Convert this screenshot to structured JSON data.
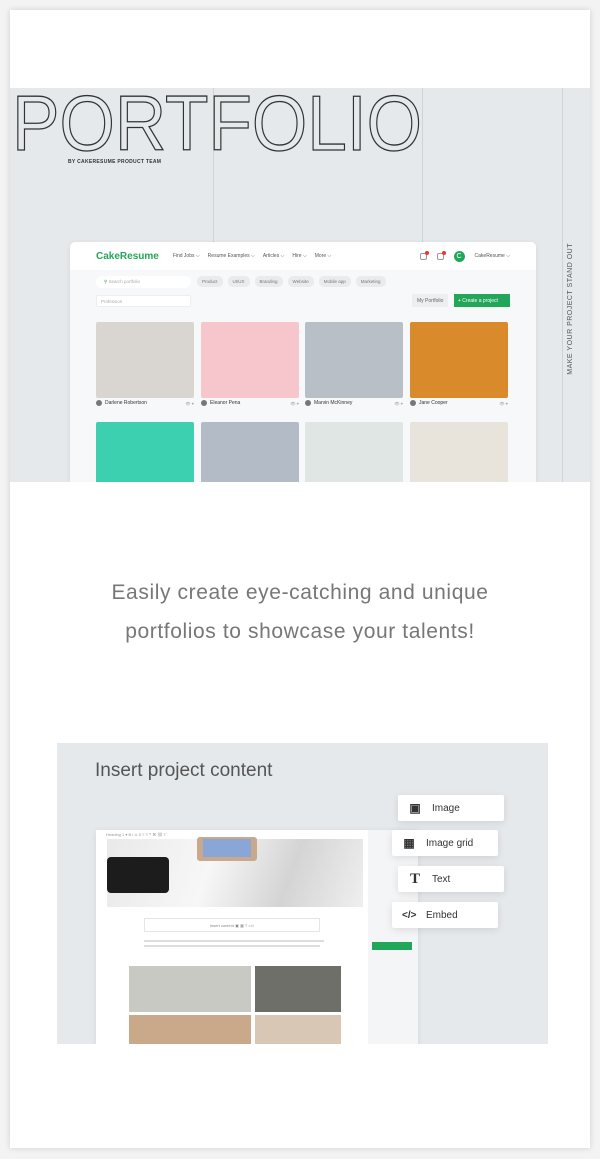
{
  "hero": {
    "title": "PORTFOLIO",
    "byline": "BY CAKERESUME PRODUCT TEAM",
    "side_text": "MAKE YOUR PROJECT STAND OUT"
  },
  "mock": {
    "logo": "CakeResume",
    "nav": [
      "Find Jobs ⌵",
      "Resume Examples ⌵",
      "Articles ⌵",
      "Hire ⌵",
      "More ⌵"
    ],
    "user": "CakeResume ⌵",
    "avatar": "C",
    "search_placeholder": "Search portfolio",
    "chips": [
      "Product",
      "UI/UX",
      "Branding",
      "Website",
      "Mobile app",
      "Marketing"
    ],
    "profession_placeholder": "Profession",
    "my_portfolio": "My Portfolio",
    "create": "+ Create a project",
    "cards": [
      {
        "name": "Darlene Robertson",
        "color": "#d9d6d2"
      },
      {
        "name": "Eleanor Pena",
        "color": "#f6c6cc"
      },
      {
        "name": "Marvin McKinney",
        "color": "#b8bfc6"
      },
      {
        "name": "Jane Cooper",
        "color": "#d98a2a"
      }
    ],
    "row2_colors": [
      "#3ccfb0",
      "#b3bcc6",
      "#dfe6e3",
      "#e8e4dc"
    ]
  },
  "tagline": [
    "Easily create eye-catching and unique",
    "portfolios to showcase your talents!"
  ],
  "insert": {
    "title": "Insert project content",
    "toolbar": "Heading 1  ▾    B  I  U  S  ≡  ≡  ❝  ⌘  ⛓  T",
    "insert_bar": "Insert content  ▣  ▦  T  </>",
    "options": [
      {
        "icon": "image-icon",
        "glyph": "▣",
        "label": "Image"
      },
      {
        "icon": "image-grid-icon",
        "glyph": "▦",
        "label": "Image grid"
      },
      {
        "icon": "text-icon",
        "glyph": "T",
        "label": "Text"
      },
      {
        "icon": "embed-icon",
        "glyph": "</>",
        "label": "Embed"
      }
    ]
  }
}
